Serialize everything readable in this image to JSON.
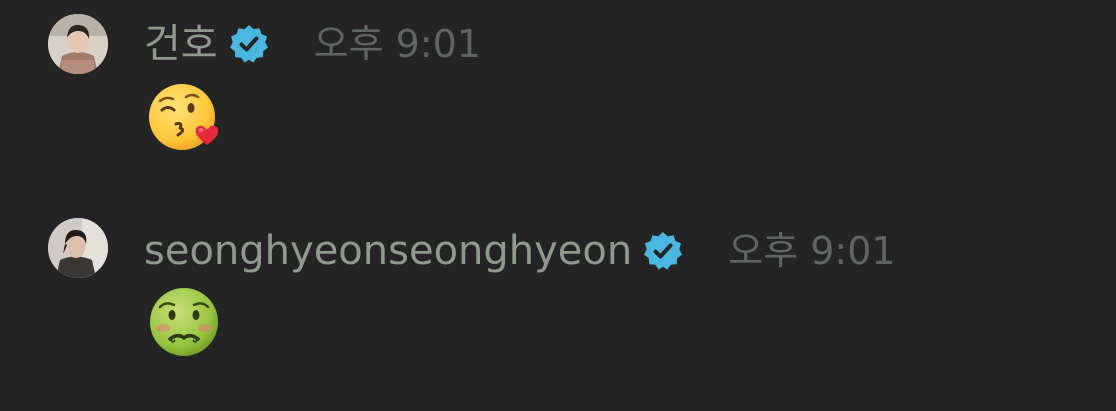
{
  "messages": [
    {
      "username": "건호",
      "verified": true,
      "time": "오후 9:01",
      "reaction_icon": "kissing-face-with-heart-emoji"
    },
    {
      "username": "seonghyeonseonghyeon",
      "verified": true,
      "time": "오후 9:01",
      "reaction_icon": "nauseated-face-emoji"
    }
  ],
  "colors": {
    "background": "#242424",
    "username": "#8f9a8c",
    "timestamp": "#5f6560",
    "verified_badge": "#49b7e0"
  }
}
